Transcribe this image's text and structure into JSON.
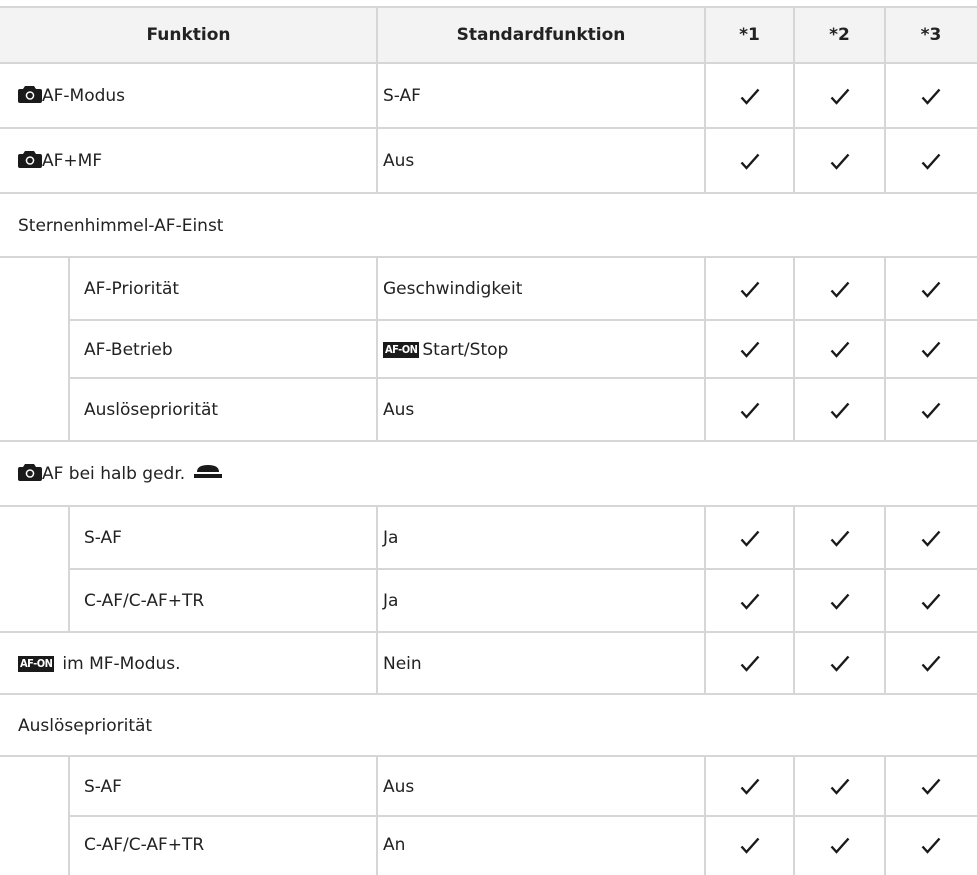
{
  "header": {
    "col_function": "Funktion",
    "col_default": "Standardfunktion",
    "col_1": "*1",
    "col_2": "*2",
    "col_3": "*3"
  },
  "rows": [
    {
      "type": "main",
      "icon": "camera-icon",
      "label": "AF-Modus",
      "value": "S-AF",
      "checks": [
        true,
        true,
        true
      ]
    },
    {
      "type": "main",
      "icon": "camera-icon",
      "label": "AF+MF",
      "value": "Aus",
      "checks": [
        true,
        true,
        true
      ]
    },
    {
      "type": "group",
      "label": "Sternenhimmel-AF-Einst"
    },
    {
      "type": "sub",
      "label": "AF-Priorität",
      "value": "Geschwindigkeit",
      "checks": [
        true,
        true,
        true
      ]
    },
    {
      "type": "sub",
      "label": "AF-Betrieb",
      "value_icon": "af-on-badge-icon",
      "value_icon_text": "AF-ON",
      "value": "Start/Stop",
      "checks": [
        true,
        true,
        true
      ]
    },
    {
      "type": "sub",
      "label": "Auslösepriorität",
      "value": "Aus",
      "checks": [
        true,
        true,
        true
      ]
    },
    {
      "type": "group",
      "icon": "camera-icon",
      "label": "AF bei halb gedr.",
      "trailing_icon": "shutter-button-icon"
    },
    {
      "type": "sub",
      "label": "S-AF",
      "value": "Ja",
      "checks": [
        true,
        true,
        true
      ]
    },
    {
      "type": "sub",
      "label": "C-AF/C-AF+TR",
      "value": "Ja",
      "checks": [
        true,
        true,
        true
      ]
    },
    {
      "type": "main",
      "icon": "af-on-badge-icon",
      "icon_text": "AF-ON",
      "label": "im MF-Modus.",
      "value": "Nein",
      "checks": [
        true,
        true,
        true
      ]
    },
    {
      "type": "group",
      "label": "Auslösepriorität"
    },
    {
      "type": "sub",
      "label": "S-AF",
      "value": "Aus",
      "checks": [
        true,
        true,
        true
      ]
    },
    {
      "type": "sub",
      "label": "C-AF/C-AF+TR",
      "value": "An",
      "checks": [
        true,
        true,
        true
      ]
    }
  ]
}
